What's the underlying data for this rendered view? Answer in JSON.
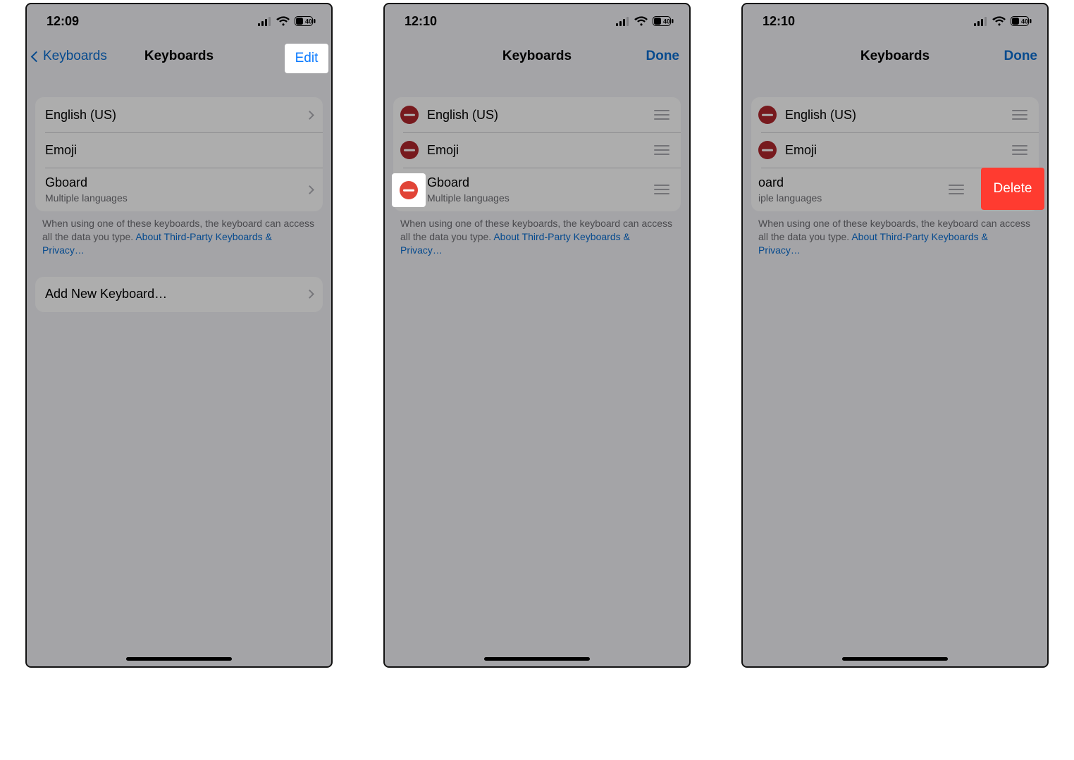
{
  "statusbar": {
    "time1": "12:09",
    "time2": "12:10",
    "time3": "12:10",
    "battery": "40"
  },
  "nav": {
    "back_label": "Keyboards",
    "title": "Keyboards",
    "edit": "Edit",
    "done": "Done"
  },
  "keyboards": {
    "items": [
      {
        "name": "English (US)",
        "sub": ""
      },
      {
        "name": "Emoji",
        "sub": ""
      },
      {
        "name": "Gboard",
        "sub": "Multiple languages"
      }
    ]
  },
  "add_row": "Add New Keyboard…",
  "footer_text": "When using one of these keyboards, the keyboard can access all the data you type. ",
  "footer_link": "About Third-Party Keyboards & Privacy…",
  "delete_label": "Delete",
  "frame3_truncated": {
    "name_suffix": "oard",
    "sub_suffix": "iple languages"
  }
}
